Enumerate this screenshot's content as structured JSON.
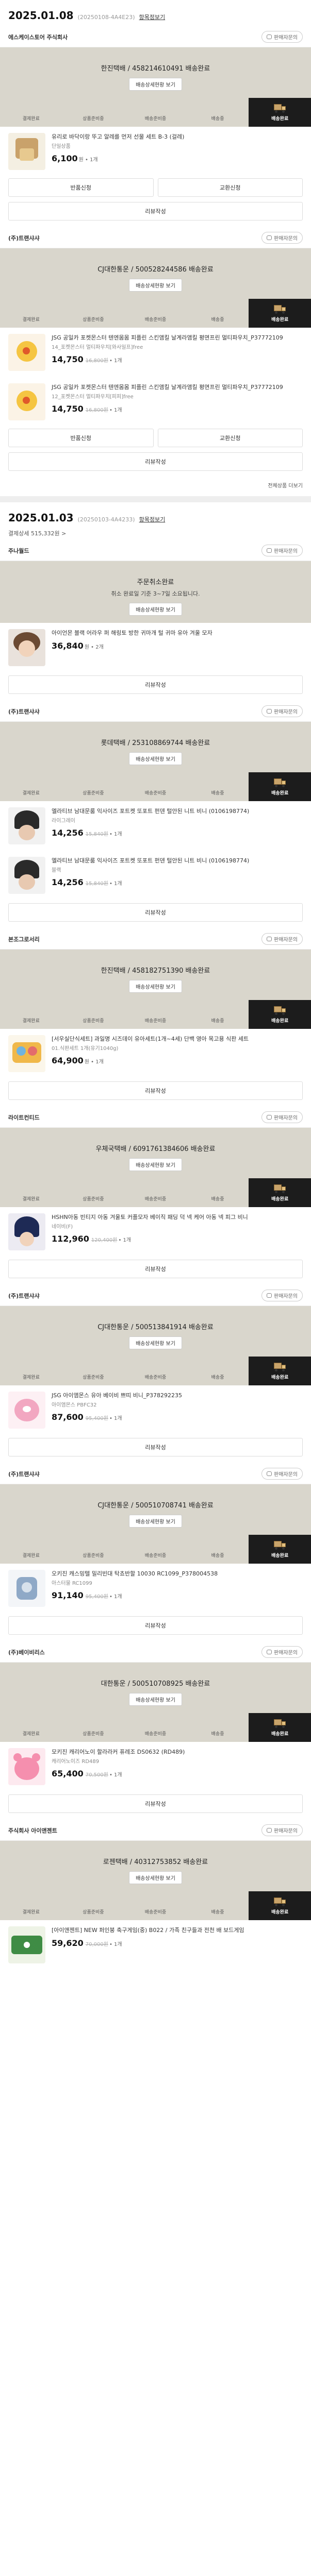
{
  "labels": {
    "detail": "항목정보기",
    "inquiry": "판매자문의",
    "track": "배송상세현황 보기",
    "steps": [
      "결제완료",
      "상품준비중",
      "배송준비중",
      "배송중",
      "배송완료"
    ],
    "exchange": "반품신청",
    "return": "교환신청",
    "review": "리뷰작성",
    "more": "전체상품 더보기"
  },
  "orders": [
    {
      "date": "2025.01.08",
      "order_no": "(20250108-4A4E23)",
      "sub": "",
      "sellers": [
        {
          "name": "에스케이스토어 주식회사",
          "status_title": "한진택배 / 458214610491 배송완료",
          "status_desc": "",
          "items": [
            {
              "name": "유리로 바닥이랑 뚜고 알레를 먼저 선물 세트 B-3 (걸레)",
              "opt": "단일상품",
              "price": "6,100",
              "orig": "",
              "qty": "원 • 1개",
              "thumb": "gift"
            }
          ],
          "buttons": "two-plus-review"
        },
        {
          "name": "(주)트랜샤샤",
          "status_title": "CJ대한통운 / 500528244586 배송완료",
          "status_desc": "",
          "items": [
            {
              "name": "JSG 공일카 포켓몬스터 텐엔몸몸 피플린 스킨앰킬 날계라앰킬 평면프린 멀티파우치_P37772109",
              "opt": "14_포켓몬스터 멀티파우치[와사일프]free",
              "price": "14,750",
              "orig": "16,800원",
              "qty": "• 1개",
              "thumb": "poke"
            },
            {
              "name": "JSG 공일카 포켓몬스터 텐엔몸몸 피플린 스킨앰킬 날계라앰킬 평면프린 멀티파우치_P37772109",
              "opt": "12_포켓몬스터 멀티파우치[피피]free",
              "price": "14,750",
              "orig": "16,800원",
              "qty": "• 1개",
              "thumb": "poke"
            }
          ],
          "buttons": "two-plus-review",
          "more": true
        }
      ]
    },
    {
      "date": "2025.01.03",
      "order_no": "(20250103-4A4233)",
      "sub": "결제상세 515,332원 >",
      "sellers": [
        {
          "name": "주나월드",
          "status_title": "주문취소완료",
          "status_desc": "취소 완료일 기준 3~7일 소요됩니다.",
          "items": [
            {
              "name": "아이언몬 블랙 어라우 퍼 해링토 방한 귀마개 털 귀마 유아 겨울 모자",
              "opt": "",
              "price": "36,840",
              "orig": "",
              "qty": "원 • 2개",
              "thumb": "kid"
            }
          ],
          "buttons": "review-only",
          "plain": true
        },
        {
          "name": "(주)트랜샤샤",
          "status_title": "롯데택배 / 253108869744 배송완료",
          "status_desc": "",
          "items": [
            {
              "name": "엘라티브 남대문룸 익사이즈 포트켓 또포트 펀덴 털안된 니트 비니 (0106198774)",
              "opt": "라이그레이",
              "price": "14,256",
              "orig": "15,840원",
              "qty": "• 1개",
              "thumb": "beanie"
            },
            {
              "name": "엘라티브 남대문룸 익사이즈 포트켓 또포트 펀덴 털안된 니트 비니 (0106198774)",
              "opt": "블랙",
              "price": "14,256",
              "orig": "15,840원",
              "qty": "• 1개",
              "thumb": "beanie"
            }
          ],
          "buttons": "review-only"
        },
        {
          "name": "본조그로서리",
          "status_title": "한진택배 / 458182751390 배송완료",
          "status_desc": "",
          "items": [
            {
              "name": "[서우실단식세트] 과일명 시즈데이 유아세트(1개~4세) 단백 영아 목고용 식판 세트",
              "opt": "01.식판세트 1개(유기1040g)",
              "price": "64,900",
              "orig": "",
              "qty": "원 • 1개",
              "thumb": "plate"
            }
          ],
          "buttons": "review-only"
        },
        {
          "name": "라이트컨티드",
          "status_title": "우체국택배 / 6091761384606 배송완료",
          "status_desc": "",
          "items": [
            {
              "name": "HSHN아동 빈티지 아동 겨울토 커플모자 베이직 패딩 덕 넥 케어 아동 넥 피그 비니",
              "opt": "네이비(F)",
              "price": "112,960",
              "orig": "120,400원",
              "qty": "• 1개",
              "thumb": "hat"
            }
          ],
          "buttons": "review-only"
        },
        {
          "name": "(주)트랜샤샤",
          "status_title": "CJ대한통운 / 500513841914 배송완료",
          "status_desc": "",
          "items": [
            {
              "name": "JSG 아이앰몬스 유아 베이비 쁘띠 비니_P378292235",
              "opt": "아이앰몬스 PBFC32",
              "price": "87,600",
              "orig": "95,400원",
              "qty": "• 1개",
              "thumb": "pink"
            }
          ],
          "buttons": "review-only"
        },
        {
          "name": "(주)트랜샤샤",
          "status_title": "CJ대한통운 / 500510708741 배송완료",
          "status_desc": "",
          "items": [
            {
              "name": "오키진 캐스밍텔 밀리빈대 탁쵸반할 10030 RC1099_P378004538",
              "opt": "아스터물 RC1099",
              "price": "91,140",
              "orig": "95,400원",
              "qty": "• 1개",
              "thumb": "bag"
            }
          ],
          "buttons": "review-only"
        },
        {
          "name": "(주)베이비리스",
          "status_title": "대한통운 / 500510708925 배송완료",
          "status_desc": "",
          "items": [
            {
              "name": "모키진 캐리어노이 할라라커 퓨레조 DS0632 (RD489)",
              "opt": "캐리어노이즈 RD489",
              "price": "65,400",
              "orig": "70,500원",
              "qty": "• 1개",
              "thumb": "pinkbear"
            }
          ],
          "buttons": "review-only"
        },
        {
          "name": "주식회사 아이앤젠트",
          "status_title": "로젠택배 / 40312753852 배송완료",
          "status_desc": "",
          "items": [
            {
              "name": "[아이앤젠트] NEW 퍼인붕 축구게임(중) B022 / 가족 친구들과 전천 배 보드게임",
              "opt": "",
              "price": "59,620",
              "orig": "70,000원",
              "qty": "• 1개",
              "thumb": "game"
            }
          ],
          "buttons": "none"
        }
      ]
    }
  ],
  "colors": {
    "band": "#d9d6cc",
    "active_step": "#1c1c1c"
  }
}
